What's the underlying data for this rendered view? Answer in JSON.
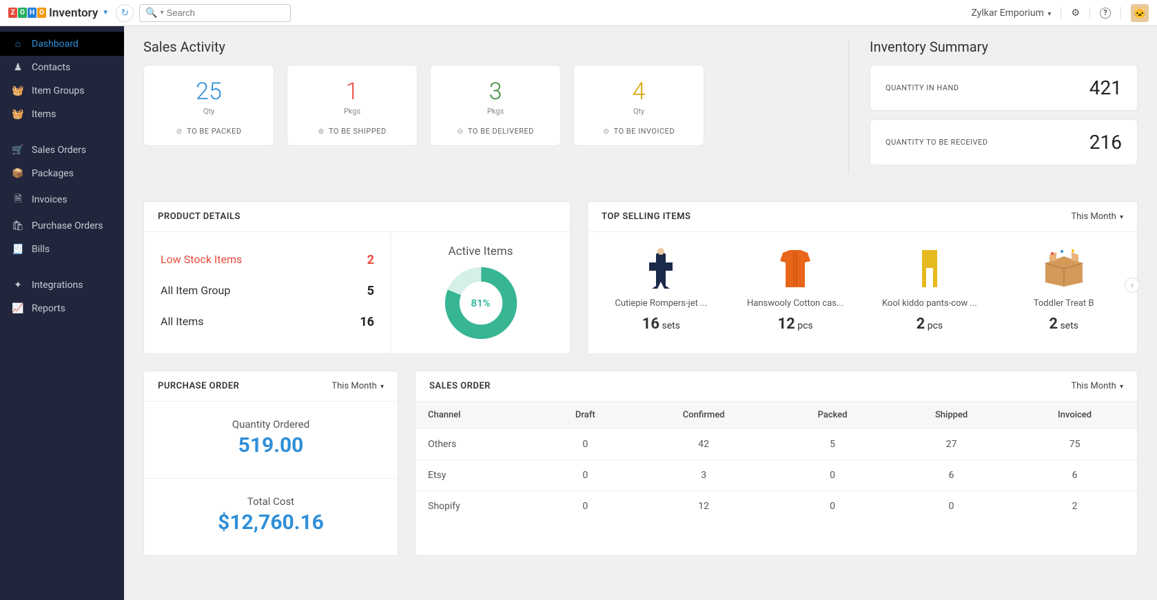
{
  "header": {
    "app_name": "Inventory",
    "search_placeholder": "Search",
    "org_name": "Zylkar Emporium"
  },
  "sidebar": {
    "items": [
      {
        "label": "Dashboard",
        "icon": "home-icon",
        "active": true
      },
      {
        "label": "Contacts",
        "icon": "user-icon"
      },
      {
        "label": "Item Groups",
        "icon": "basket-icon"
      },
      {
        "label": "Items",
        "icon": "basket-icon"
      }
    ],
    "items2": [
      {
        "label": "Sales Orders",
        "icon": "cart-icon"
      },
      {
        "label": "Packages",
        "icon": "box-icon"
      },
      {
        "label": "Invoices",
        "icon": "file-icon"
      },
      {
        "label": "Purchase Orders",
        "icon": "bag-icon"
      },
      {
        "label": "Bills",
        "icon": "receipt-icon"
      }
    ],
    "items3": [
      {
        "label": "Integrations",
        "icon": "plug-icon"
      },
      {
        "label": "Reports",
        "icon": "chart-icon"
      }
    ]
  },
  "sales_activity": {
    "title": "Sales Activity",
    "cards": [
      {
        "value": "25",
        "unit": "Qty",
        "label": "TO BE PACKED",
        "color": "num-blue",
        "icon": "check-circle-icon"
      },
      {
        "value": "1",
        "unit": "Pkgs",
        "label": "TO BE SHIPPED",
        "color": "num-red",
        "icon": "arrow-circle-icon"
      },
      {
        "value": "3",
        "unit": "Pkgs",
        "label": "TO BE DELIVERED",
        "color": "num-green",
        "icon": "dash-circle-icon"
      },
      {
        "value": "4",
        "unit": "Qty",
        "label": "TO BE INVOICED",
        "color": "num-amber",
        "icon": "dollar-circle-icon"
      }
    ]
  },
  "inventory_summary": {
    "title": "Inventory Summary",
    "rows": [
      {
        "label": "QUANTITY IN HAND",
        "value": "421"
      },
      {
        "label": "QUANTITY TO BE RECEIVED",
        "value": "216"
      }
    ]
  },
  "product_details": {
    "title": "PRODUCT DETAILS",
    "rows": [
      {
        "label": "Low Stock Items",
        "value": "2",
        "red": true
      },
      {
        "label": "All Item Group",
        "value": "5"
      },
      {
        "label": "All Items",
        "value": "16"
      }
    ],
    "donut": {
      "title": "Active Items",
      "percent": 81,
      "percent_label": "81%"
    }
  },
  "top_selling": {
    "title": "TOP SELLING ITEMS",
    "period": "This Month",
    "items": [
      {
        "name": "Cutiepie Rompers-jet ...",
        "qty": "16",
        "unit": "sets"
      },
      {
        "name": "Hanswooly Cotton cas...",
        "qty": "12",
        "unit": "pcs"
      },
      {
        "name": "Kool kiddo pants-cow ...",
        "qty": "2",
        "unit": "pcs"
      },
      {
        "name": "Toddler Treat B",
        "qty": "2",
        "unit": "sets"
      }
    ]
  },
  "purchase_order": {
    "title": "PURCHASE ORDER",
    "period": "This Month",
    "qty_label": "Quantity Ordered",
    "qty_value": "519.00",
    "cost_label": "Total Cost",
    "cost_value": "$12,760.16"
  },
  "sales_order": {
    "title": "SALES ORDER",
    "period": "This Month",
    "columns": [
      "Channel",
      "Draft",
      "Confirmed",
      "Packed",
      "Shipped",
      "Invoiced"
    ],
    "rows": [
      {
        "channel": "Others",
        "draft": "0",
        "confirmed": "42",
        "packed": "5",
        "shipped": "27",
        "invoiced": "75"
      },
      {
        "channel": "Etsy",
        "draft": "0",
        "confirmed": "3",
        "packed": "0",
        "shipped": "6",
        "invoiced": "6"
      },
      {
        "channel": "Shopify",
        "draft": "0",
        "confirmed": "12",
        "packed": "0",
        "shipped": "0",
        "invoiced": "2"
      }
    ]
  },
  "chart_data": {
    "type": "pie",
    "title": "Active Items",
    "series": [
      {
        "name": "Active",
        "values": [
          81
        ]
      },
      {
        "name": "Inactive",
        "values": [
          19
        ]
      }
    ]
  }
}
